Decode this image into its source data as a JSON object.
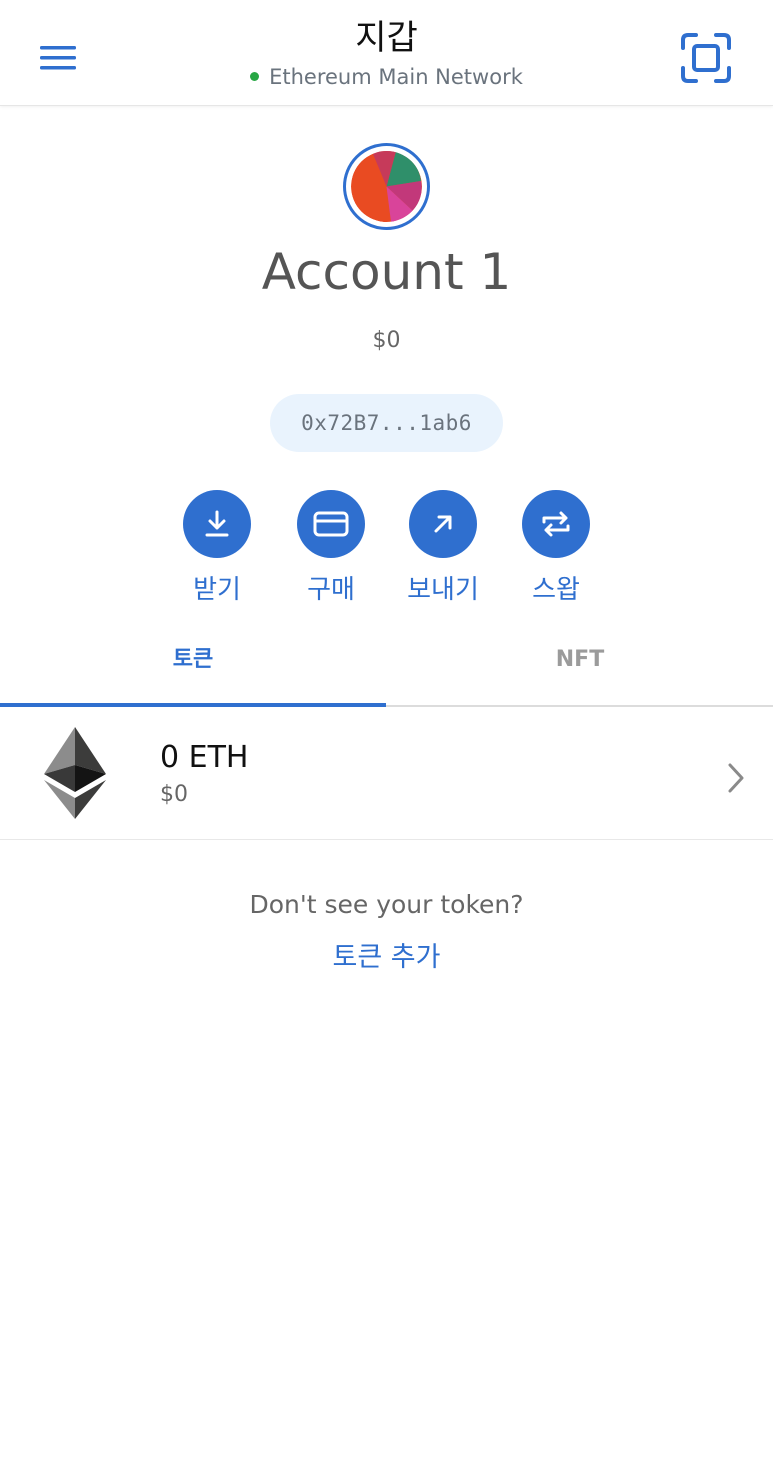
{
  "header": {
    "title": "지갑",
    "network": "Ethereum Main Network",
    "network_status_color": "#28a745",
    "menu_icon": "hamburger-menu-icon",
    "scan_icon": "qr-scan-icon"
  },
  "account": {
    "name": "Account 1",
    "balance": "$0",
    "address": "0x72B7...1ab6"
  },
  "actions": [
    {
      "label": "받기",
      "icon": "download-icon"
    },
    {
      "label": "구매",
      "icon": "credit-card-icon"
    },
    {
      "label": "보내기",
      "icon": "arrow-up-right-icon"
    },
    {
      "label": "스왑",
      "icon": "swap-icon"
    }
  ],
  "tabs": [
    {
      "label": "토큰",
      "active": true
    },
    {
      "label": "NFT",
      "active": false
    }
  ],
  "tokens": [
    {
      "amount": "0 ETH",
      "fiat": "$0",
      "icon": "ethereum-icon"
    }
  ],
  "footer": {
    "prompt": "Don't see your token?",
    "add_token": "토큰 추가"
  },
  "colors": {
    "accent": "#2f6fcf",
    "address_bg": "#e9f3fd"
  }
}
